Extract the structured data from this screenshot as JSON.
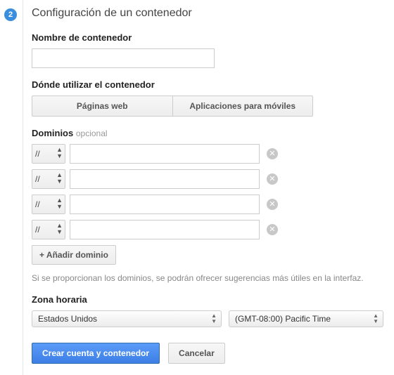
{
  "step_number": "2",
  "title": "Configuración de un contenedor",
  "name_section": {
    "label": "Nombre de contenedor",
    "value": ""
  },
  "usage_section": {
    "label": "Dónde utilizar el contenedor",
    "option_web": "Páginas web",
    "option_mobile": "Aplicaciones para móviles"
  },
  "domains_section": {
    "label": "Dominios",
    "optional": "opcional",
    "rows": [
      {
        "protocol": "//",
        "value": ""
      },
      {
        "protocol": "//",
        "value": ""
      },
      {
        "protocol": "//",
        "value": ""
      },
      {
        "protocol": "//",
        "value": ""
      }
    ],
    "add_button": "+ Añadir dominio",
    "hint": "Si se proporcionan los dominios, se podrán ofrecer sugerencias más útiles en la interfaz."
  },
  "timezone_section": {
    "label": "Zona horaria",
    "country": "Estados Unidos",
    "zone": "(GMT-08:00) Pacific Time"
  },
  "actions": {
    "primary": "Crear cuenta y contenedor",
    "secondary": "Cancelar"
  }
}
